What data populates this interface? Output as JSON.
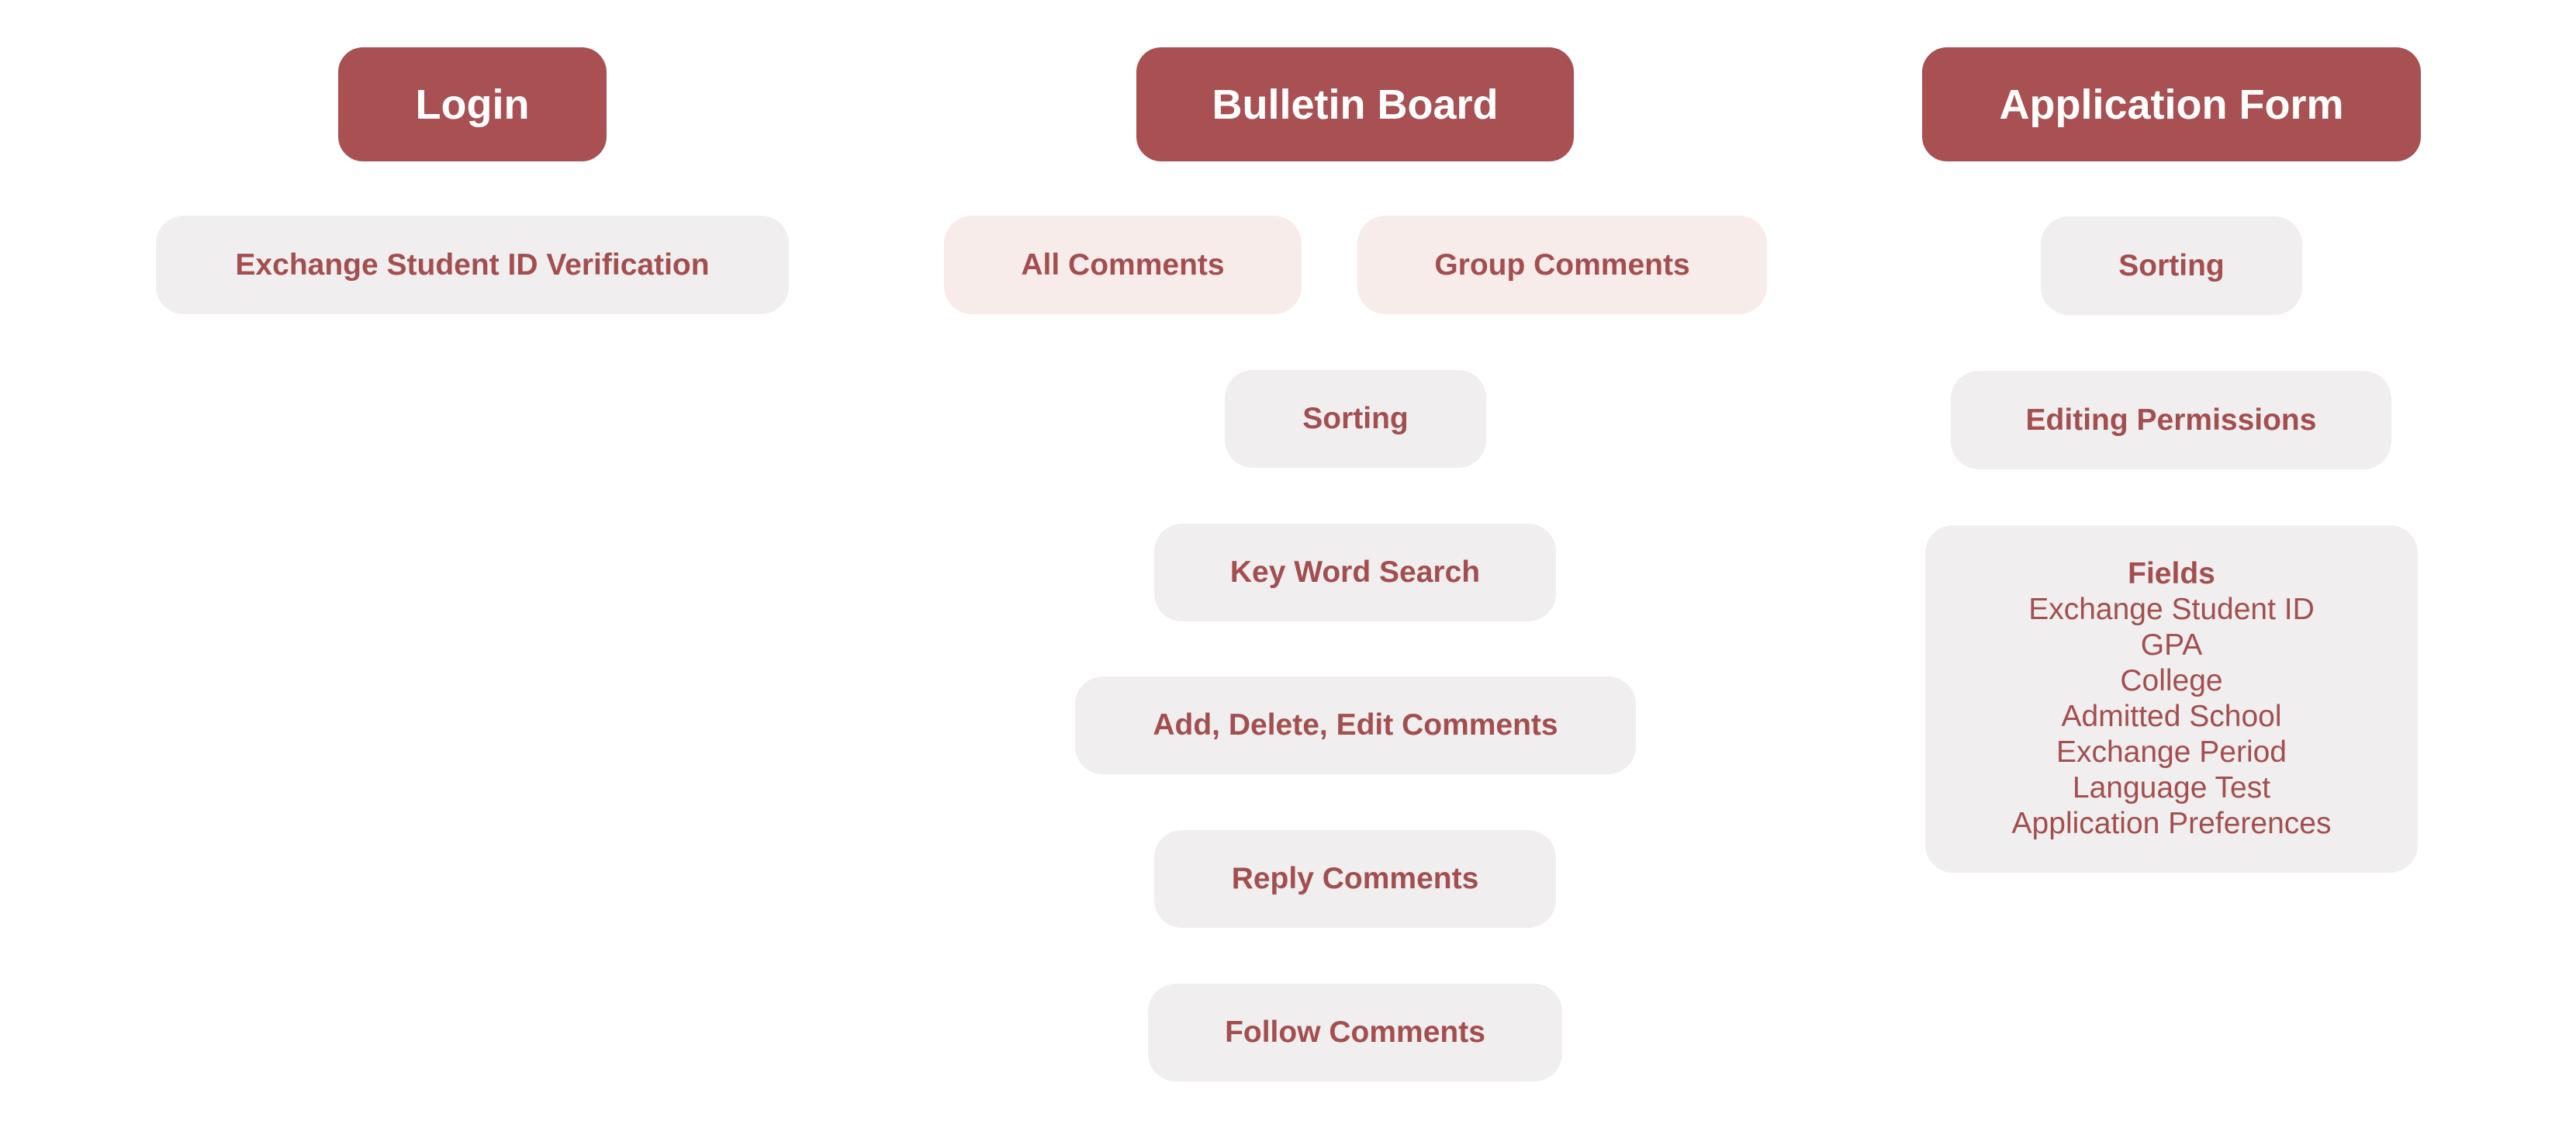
{
  "colors": {
    "header_bg": "#a85052",
    "header_text": "#ffffff",
    "node_bg": "#f0eeef",
    "node_bg_highlight": "#f8ecea",
    "node_text": "#a34e4f"
  },
  "login": {
    "title": "Login",
    "items": [
      "Exchange Student ID Verification"
    ]
  },
  "bulletin": {
    "title": "Bulletin Board",
    "items": [
      "All Comments",
      "Group Comments",
      "Sorting",
      "Key Word Search",
      "Add, Delete, Edit Comments",
      "Reply Comments",
      "Follow Comments"
    ]
  },
  "application": {
    "title": "Application Form",
    "items": [
      "Sorting",
      "Editing Permissions"
    ],
    "fields": {
      "title": "Fields",
      "items": [
        "Exchange Student ID",
        "GPA",
        "College",
        "Admitted School",
        "Exchange Period",
        "Language Test",
        "Application Preferences"
      ]
    }
  }
}
